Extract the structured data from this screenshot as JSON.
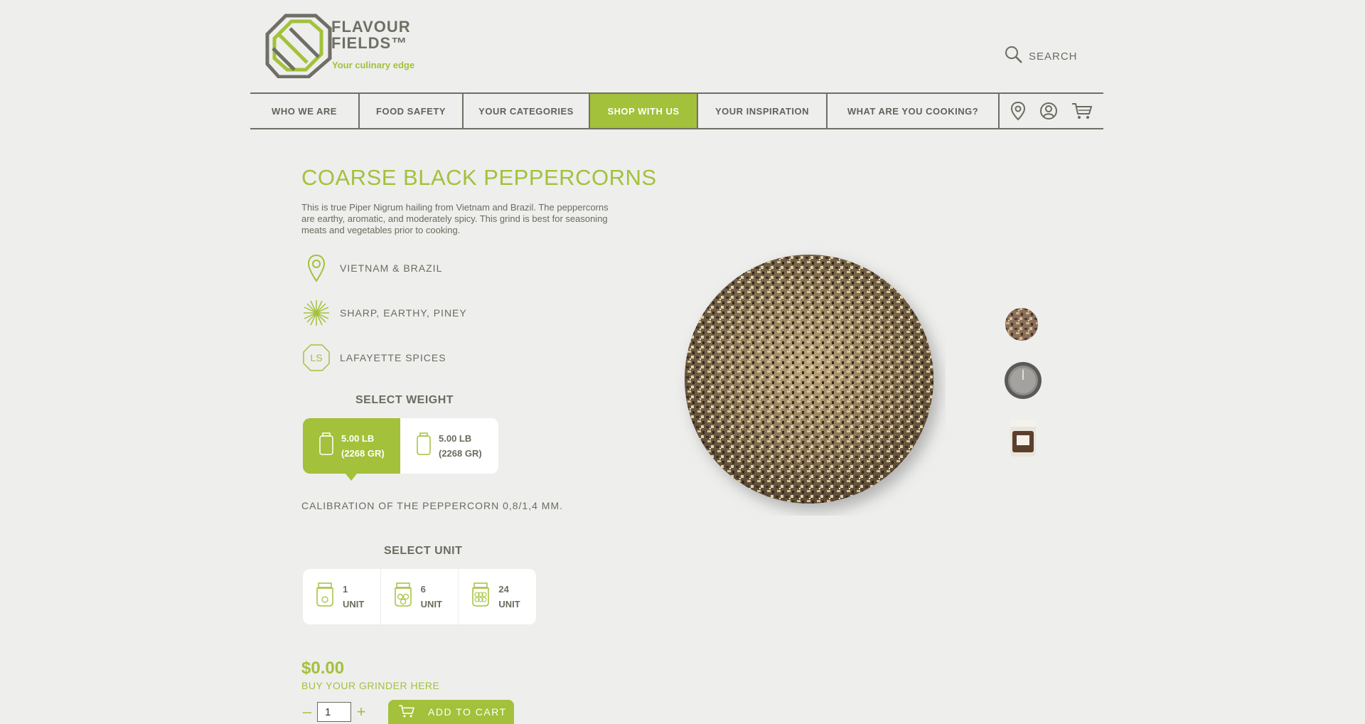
{
  "brand": {
    "name_line1": "FLAVOUR",
    "name_line2": "FIELDS™",
    "tagline": "Your culinary edge",
    "accent_color": "#a3c13a",
    "text_color": "#6b6b5f"
  },
  "header": {
    "search_label": "SEARCH",
    "search_icon": "magnifier-icon"
  },
  "nav": {
    "items": [
      {
        "label": "WHO WE ARE"
      },
      {
        "label": "FOOD SAFETY"
      },
      {
        "label": "YOUR CATEGORIES"
      },
      {
        "label": "SHOP WITH US",
        "active": true
      },
      {
        "label": "YOUR INSPIRATION"
      },
      {
        "label": "WHAT ARE YOU COOKING?"
      }
    ],
    "icons": [
      "location-pin-icon",
      "user-account-icon",
      "shopping-cart-icon"
    ]
  },
  "product": {
    "title": "COARSE BLACK PEPPERCORNS",
    "description": "This is true Piper Nigrum hailing from Vietnam and Brazil. The peppercorns are earthy, aromatic, and moderately spicy. This grind is best for seasoning meats and vegetables prior to cooking.",
    "origin": "VIETNAM & BRAZIL",
    "flavor": "SHARP, EARTHY, PINEY",
    "brand_badge": "LS",
    "brand": "LAFAYETTE SPICES",
    "select_weight_label": "SELECT WEIGHT",
    "weights": [
      {
        "line1": "5.00 LB",
        "line2": "(2268 GR)",
        "selected": true
      },
      {
        "line1": "5.00 LB",
        "line2": "(2268 GR)",
        "selected": false
      }
    ],
    "calibration": "CALIBRATION OF THE PEPPERCORN 0,8/1,4 MM.",
    "select_unit_label": "SELECT UNIT",
    "units": [
      {
        "count": "1",
        "label": "UNIT"
      },
      {
        "count": "6",
        "label": "UNIT"
      },
      {
        "count": "24",
        "label": "UNIT"
      }
    ],
    "price": "$0.00",
    "grinder_link": "BUY YOUR GRINDER HERE",
    "quantity": "1",
    "qty_minus": "–",
    "qty_plus": "+",
    "add_to_cart": "ADD TO CART"
  },
  "gallery": {
    "main_image": "ground-pepper-pile",
    "thumbnails": [
      "ground-pepper-thumb",
      "tin-lid-thumb",
      "jar-thumb"
    ]
  }
}
